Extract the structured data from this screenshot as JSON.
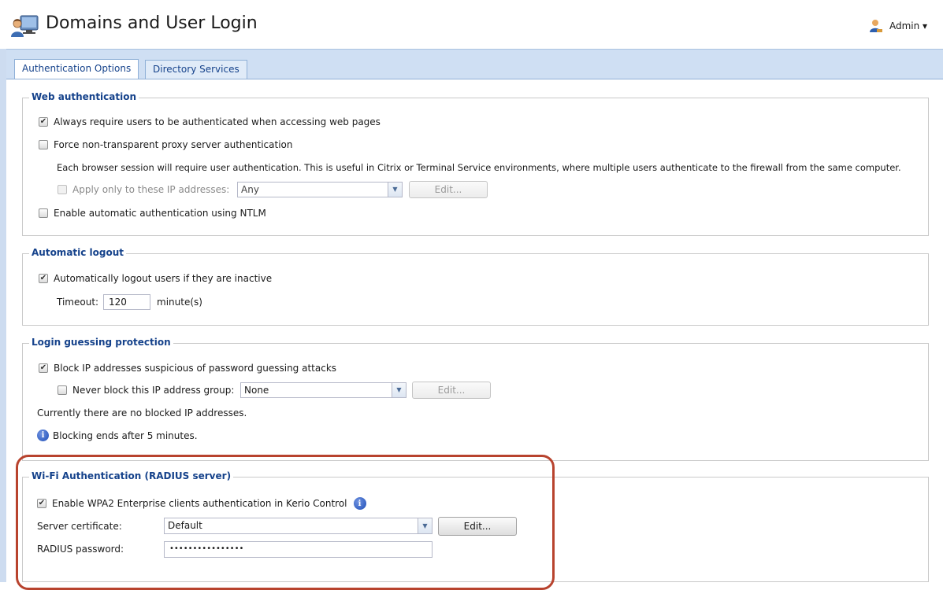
{
  "header": {
    "title": "Domains and User Login",
    "user_label": "Admin ▾"
  },
  "tabs": [
    {
      "label": "Authentication Options",
      "active": true
    },
    {
      "label": "Directory Services",
      "active": false
    }
  ],
  "web_auth": {
    "legend": "Web authentication",
    "always_require": {
      "label": "Always require users to be authenticated when accessing web pages",
      "checked": true
    },
    "force_proxy": {
      "label": "Force non-transparent proxy server authentication",
      "checked": false
    },
    "description": "Each browser session will require user authentication. This is useful in Citrix or Terminal Service environments, where multiple users authenticate to the firewall from the same computer.",
    "apply_only": {
      "label": "Apply only to these IP addresses:",
      "checked": false,
      "disabled": true
    },
    "ip_select_value": "Any",
    "edit_label": "Edit...",
    "ntlm": {
      "label": "Enable automatic authentication using NTLM",
      "checked": false
    }
  },
  "auto_logout": {
    "legend": "Automatic logout",
    "logout_inactive": {
      "label": "Automatically logout users if they are inactive",
      "checked": true
    },
    "timeout_label": "Timeout:",
    "timeout_value": "120",
    "unit_label": "minute(s)"
  },
  "login_guess": {
    "legend": "Login guessing protection",
    "block_suspicious": {
      "label": "Block IP addresses suspicious of password guessing attacks",
      "checked": true
    },
    "never_block": {
      "label": "Never block this IP address group:",
      "checked": false
    },
    "group_select_value": "None",
    "edit_label": "Edit...",
    "status_text": "Currently there are no blocked IP addresses.",
    "info_text": "Blocking ends after 5 minutes."
  },
  "wifi": {
    "legend": "Wi-Fi Authentication (RADIUS server)",
    "enable_wpa2": {
      "label": "Enable WPA2 Enterprise clients authentication in Kerio Control",
      "checked": true
    },
    "cert_label": "Server certificate:",
    "cert_value": "Default",
    "edit_label": "Edit...",
    "radius_label": "RADIUS password:",
    "radius_value": "••••••••••••••••"
  },
  "colors": {
    "accent": "#15428b",
    "highlight": "#b8432e",
    "tab_strip": "#cfdff3"
  }
}
